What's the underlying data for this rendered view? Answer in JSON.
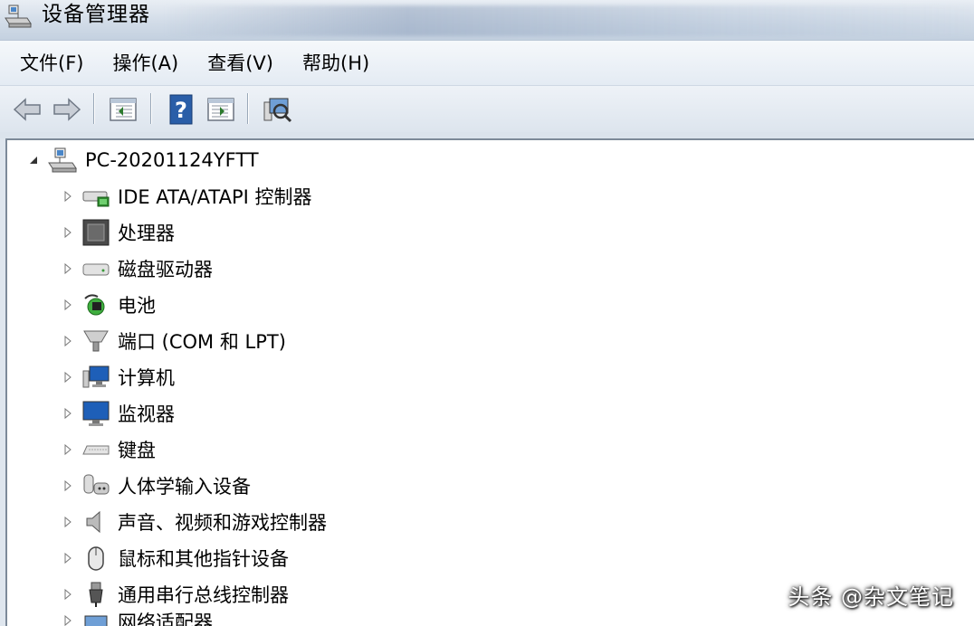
{
  "window": {
    "title": "设备管理器"
  },
  "menu": {
    "items": [
      "文件(F)",
      "操作(A)",
      "查看(V)",
      "帮助(H)"
    ]
  },
  "toolbar": {
    "buttons": [
      "back-arrow-icon",
      "forward-arrow-icon",
      "properties-panel-icon",
      "help-icon",
      "show-panel-icon",
      "scan-hardware-icon"
    ]
  },
  "tree": {
    "root": "PC-20201124YFTT",
    "items": [
      "IDE ATA/ATAPI 控制器",
      "处理器",
      "磁盘驱动器",
      "电池",
      "端口 (COM 和 LPT)",
      "计算机",
      "监视器",
      "键盘",
      "人体学输入设备",
      "声音、视频和游戏控制器",
      "鼠标和其他指针设备",
      "通用串行总线控制器",
      "网络适配器"
    ]
  },
  "watermark": "头条 @杂文笔记",
  "colors": {
    "accent": "#2a5ea8",
    "background": "#ffffff"
  }
}
